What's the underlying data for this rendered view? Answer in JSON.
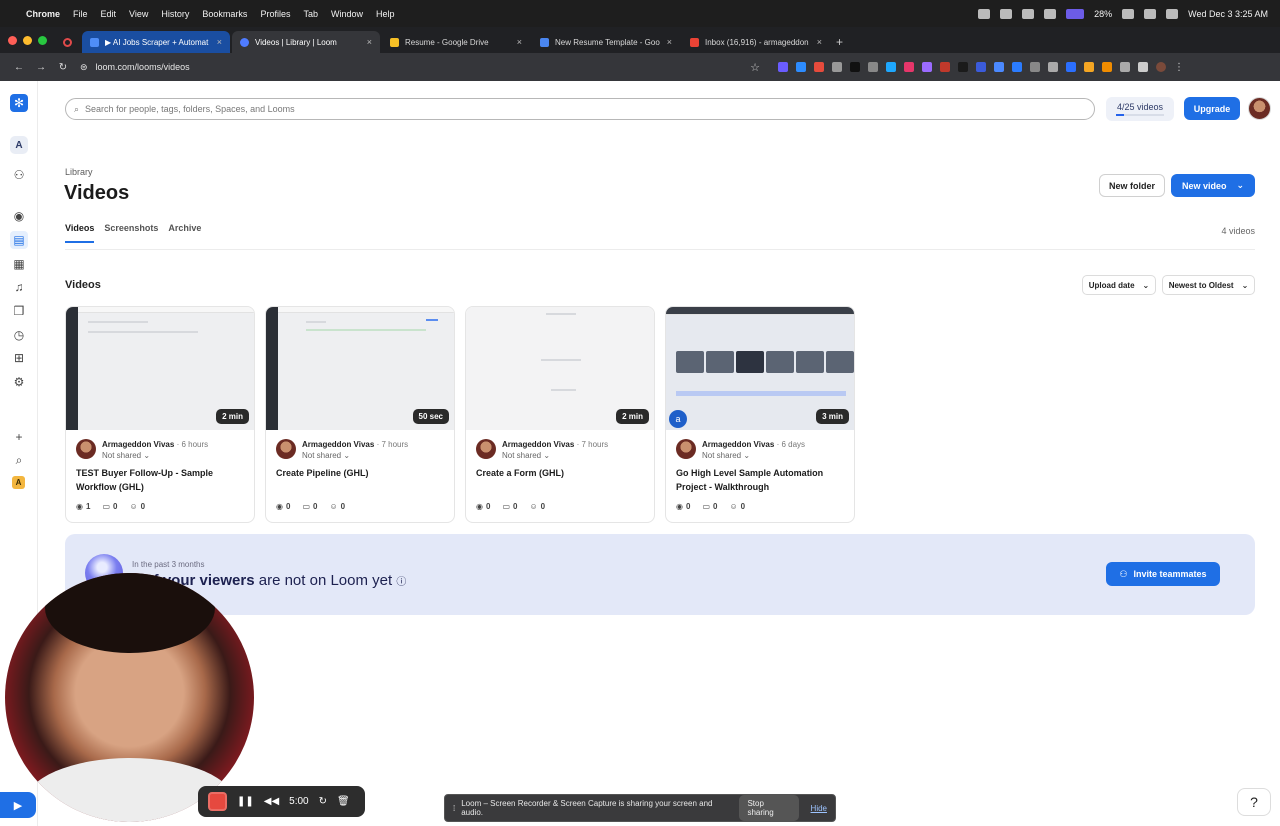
{
  "menubar": {
    "apple": "",
    "app": "Chrome",
    "items": [
      "File",
      "Edit",
      "View",
      "History",
      "Bookmarks",
      "Profiles",
      "Tab",
      "Window",
      "Help"
    ],
    "battery": "28%",
    "datetime": "Wed Dec 3  3:25 AM"
  },
  "tabs": [
    {
      "title": "▶ AI Jobs Scraper + Automat",
      "close": "×",
      "color": "#4f8ef7"
    },
    {
      "title": "Videos | Library | Loom",
      "close": "×",
      "color": "#4f7cff"
    },
    {
      "title": "Resume - Google Drive",
      "close": "×",
      "color": "#f6c026"
    },
    {
      "title": "New Resume Template - Goo",
      "close": "×",
      "color": "#4a86f0"
    },
    {
      "title": "Inbox (16,916) - armageddon",
      "close": "×",
      "color": "#ea4335"
    }
  ],
  "url": "loom.com/looms/videos",
  "search": {
    "placeholder": "Search for people, tags, folders, Spaces, and Looms"
  },
  "video_counter": {
    "label": "4/25 videos",
    "fraction": 0.16
  },
  "upgrade_label": "Upgrade",
  "sidebar": {
    "workspace_initial": "A",
    "bottom_initial": "A"
  },
  "page": {
    "breadcrumb": "Library",
    "title": "Videos",
    "new_folder": "New folder",
    "new_video": "New video",
    "tabs": [
      "Videos",
      "Screenshots",
      "Archive"
    ],
    "count": "4 videos",
    "section_title": "Videos",
    "sort_field": "Upload date",
    "sort_order": "Newest to Oldest"
  },
  "videos": [
    {
      "author": "Armageddon Vivas",
      "age": "· 6 hours",
      "share": "Not shared",
      "title": "TEST Buyer Follow-Up - Sample Workflow (GHL)",
      "duration": "2 min",
      "views": "1",
      "comments": "0",
      "reactions": "0"
    },
    {
      "author": "Armageddon Vivas",
      "age": "· 7 hours",
      "share": "Not shared",
      "title": "Create Pipeline (GHL)",
      "duration": "50 sec",
      "views": "0",
      "comments": "0",
      "reactions": "0"
    },
    {
      "author": "Armageddon Vivas",
      "age": "· 7 hours",
      "share": "Not shared",
      "title": "Create a Form (GHL)",
      "duration": "2 min",
      "views": "0",
      "comments": "0",
      "reactions": "0"
    },
    {
      "author": "Armageddon Vivas",
      "age": "· 6 days",
      "share": "Not shared",
      "title": "Go High Level Sample Automation Project - Walkthrough",
      "duration": "3 min",
      "views": "0",
      "comments": "0",
      "reactions": "0",
      "badge": "a"
    }
  ],
  "banner": {
    "kicker": "In the past 3 months",
    "headline_bold": "2 of your viewers",
    "headline_rest": "are not on Loom yet",
    "invite": "Invite teammates"
  },
  "recorder": {
    "timer": "5:00"
  },
  "sharebar": {
    "text": "Loom – Screen Recorder & Screen Capture is sharing your screen and audio.",
    "stop": "Stop sharing",
    "hide": "Hide"
  },
  "help": "?"
}
